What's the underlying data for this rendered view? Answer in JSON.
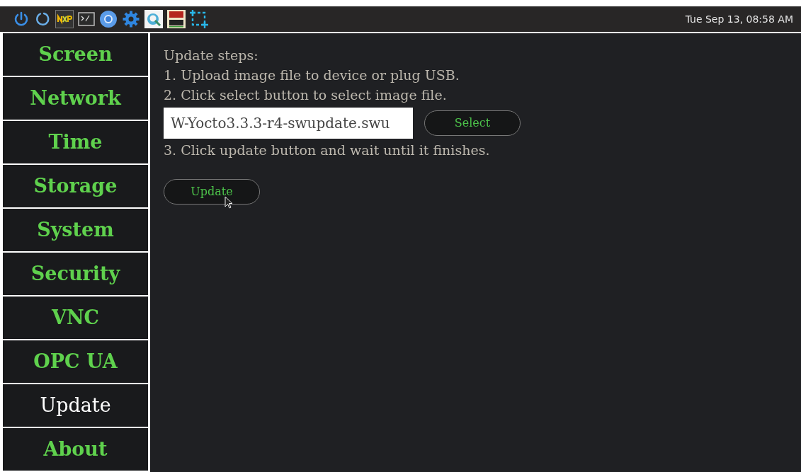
{
  "taskbar": {
    "clock": "Tue Sep 13, 08:58 AM"
  },
  "sidebar": {
    "items": [
      {
        "label": "Screen",
        "selected": false
      },
      {
        "label": "Network",
        "selected": false
      },
      {
        "label": "Time",
        "selected": false
      },
      {
        "label": "Storage",
        "selected": false
      },
      {
        "label": "System",
        "selected": false
      },
      {
        "label": "Security",
        "selected": false
      },
      {
        "label": "VNC",
        "selected": false
      },
      {
        "label": "OPC UA",
        "selected": false
      },
      {
        "label": "Update",
        "selected": true
      },
      {
        "label": "About",
        "selected": false
      }
    ]
  },
  "content": {
    "heading": "Update steps:",
    "step_1": "1. Upload image file to device or plug USB.",
    "step_2": "2. Click select button to select image file.",
    "file_field": {
      "value": "W-Yocto3.3.3-r4-swupdate.swu"
    },
    "select_button": "Select",
    "step_3": "3. Click update button and wait until it finishes.",
    "update_button": "Update"
  }
}
